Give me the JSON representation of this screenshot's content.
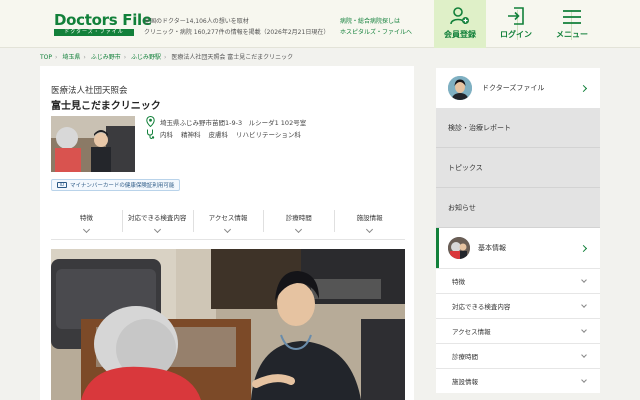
{
  "header": {
    "logo_main": "Doctors File",
    "logo_sub": "ドクターズ・ファイル",
    "tagline_line1": "全国のドクター14,106人の想いを取材",
    "tagline_line2": "クリニック・病院 160,277件の情報を掲載（2026年2月21日現在）",
    "hospital_link_line1": "病院・総合病院探しは",
    "hospital_link_line2": "ホスピタルズ・ファイルへ",
    "register_label": "会員登録",
    "login_label": "ログイン",
    "menu_label": "メニュー",
    "accent_color": "#12803a"
  },
  "breadcrumb": [
    "TOP",
    "埼玉県",
    "ふじみ野市",
    "ふじみ野駅",
    "医療法人社団天照会 富士見こだまクリニック"
  ],
  "clinic": {
    "corporation": "医療法人社団天照会",
    "name": "富士見こだまクリニック",
    "address": "埼玉県ふじみ野市苗間1-9-3　ルシーダ1 102号室",
    "departments": [
      "内科",
      "精神科",
      "皮膚科",
      "リハビリテーション科"
    ],
    "my_number_badge": "マイナンバーカードの健康保険証利用可能"
  },
  "tabs": [
    "特徴",
    "対応できる検査内容",
    "アクセス情報",
    "診療時間",
    "施設情報"
  ],
  "sidebar": {
    "doctors_file_link": "ドクターズファイル",
    "gray_items": [
      "検診・治療レポート",
      "トピックス",
      "お知らせ"
    ],
    "basic_info_label": "基本情報",
    "sub_items": [
      "特徴",
      "対応できる検査内容",
      "アクセス情報",
      "診療時間",
      "施設情報"
    ]
  }
}
